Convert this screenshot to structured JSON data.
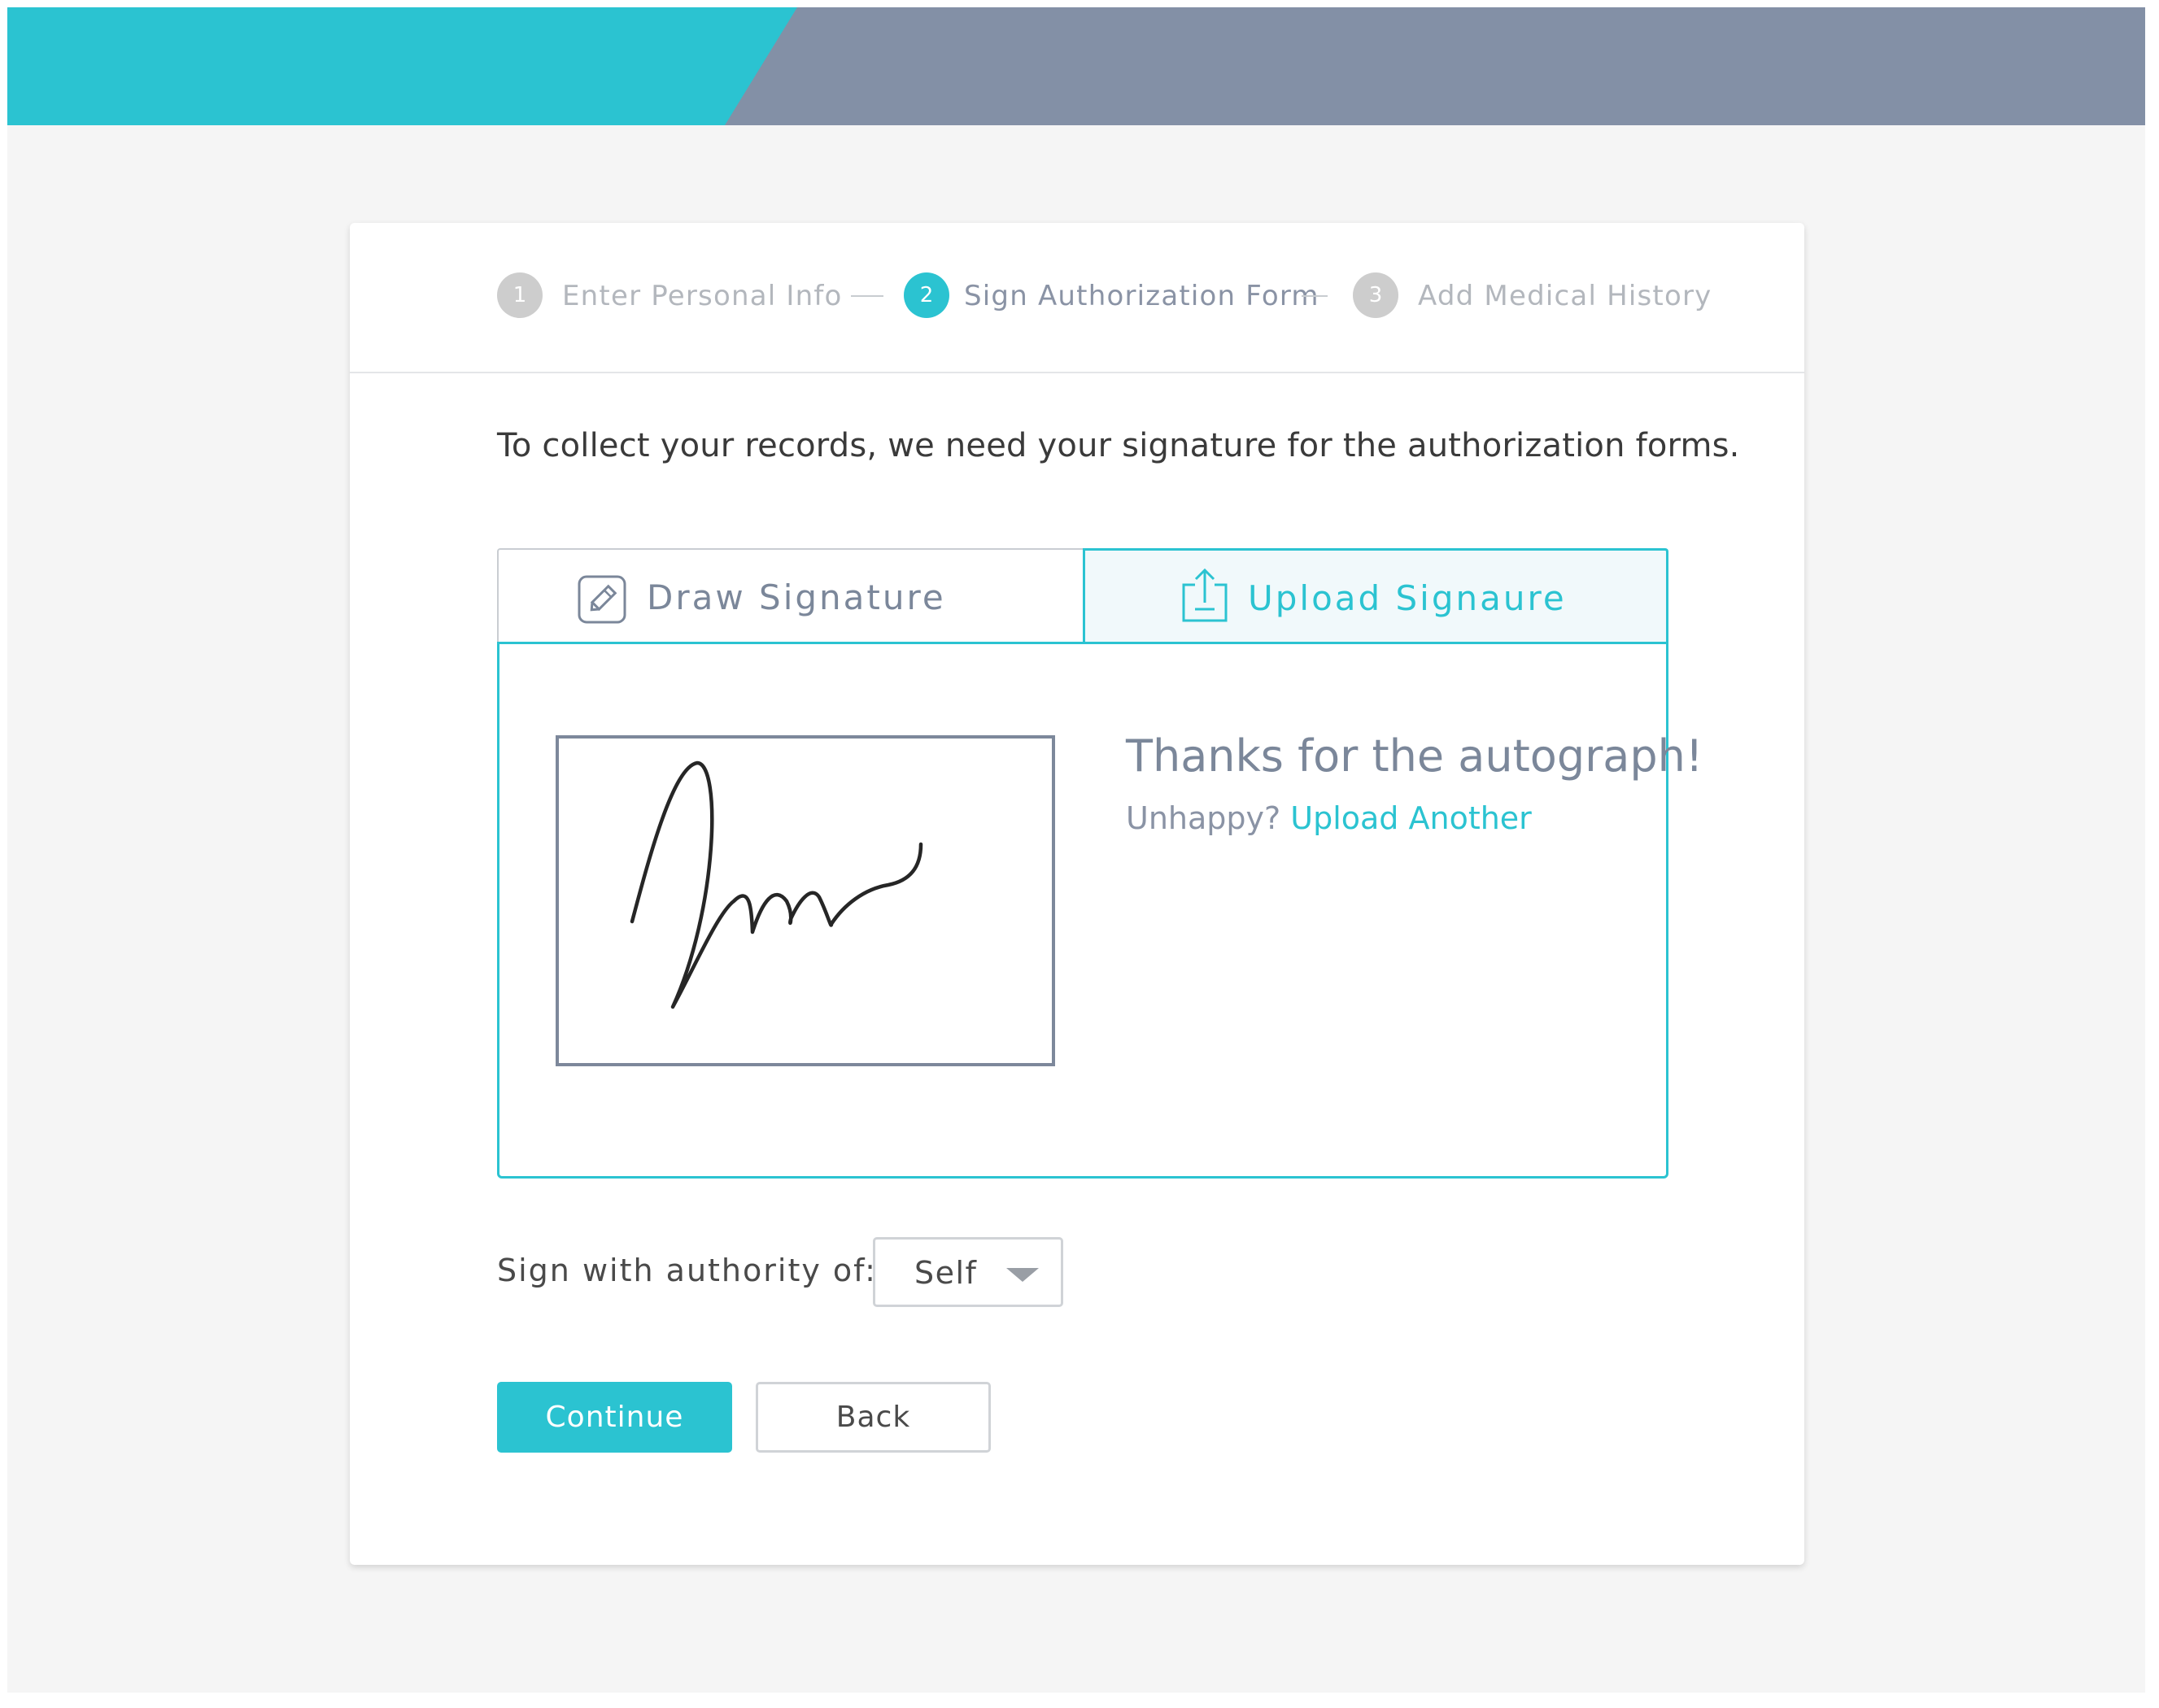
{
  "banner": {
    "accent_color": "#2bc3d1",
    "secondary_color": "#8390a6"
  },
  "stepper": {
    "steps": [
      {
        "number": "1",
        "label": "Enter Personal Info",
        "state": "inactive"
      },
      {
        "number": "2",
        "label": "Sign Authorization Form",
        "state": "active"
      },
      {
        "number": "3",
        "label": "Add Medical History",
        "state": "inactive"
      }
    ]
  },
  "intro_text": "To collect your records, we need your signature for the authorization forms.",
  "signature": {
    "tabs": [
      {
        "label": "Draw Signature",
        "icon": "pen-square-icon",
        "selected": false
      },
      {
        "label": "Upload Signaure",
        "icon": "upload-icon",
        "selected": true
      }
    ],
    "thanks_text": "Thanks for the autograph!",
    "unhappy_text": "Unhappy?",
    "upload_another_label": "Upload Another"
  },
  "authority": {
    "label": "Sign with authority of:",
    "selected": "Self",
    "caret_icon": "caret-down-icon"
  },
  "buttons": {
    "continue_label": "Continue",
    "back_label": "Back"
  }
}
